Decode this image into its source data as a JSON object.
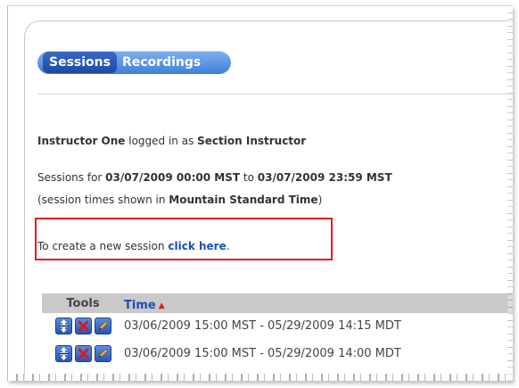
{
  "tabs": [
    {
      "label": "Sessions",
      "active": true
    },
    {
      "label": "Recordings",
      "active": false
    }
  ],
  "login": {
    "user": "Instructor One",
    "middle": " logged in as ",
    "role": "Section Instructor"
  },
  "sessions": {
    "prefix": "Sessions for ",
    "start": "03/07/2009 00:00 MST",
    "middle": " to ",
    "end": "03/07/2009 23:59 MST",
    "tz_prefix": "(session times shown in ",
    "timezone": "Mountain Standard Time",
    "tz_suffix": ")"
  },
  "create": {
    "prefix": "To create a new session ",
    "link": "click here",
    "suffix": "."
  },
  "table": {
    "headers": {
      "tools": "Tools",
      "time": "Time"
    },
    "rows": [
      {
        "time": "03/06/2009 15:00 MST - 05/29/2009 14:15 MDT"
      },
      {
        "time": "03/06/2009 15:00 MST - 05/29/2009 14:00 MDT"
      }
    ]
  },
  "icons": [
    "move-icon",
    "delete-icon",
    "edit-icon",
    "sort-ascending-icon"
  ],
  "colors": {
    "accent": "#1d4fb6",
    "tab_bar": "#4f8ae0",
    "highlight": "#e02020",
    "header_bg": "#c9c9c9"
  }
}
